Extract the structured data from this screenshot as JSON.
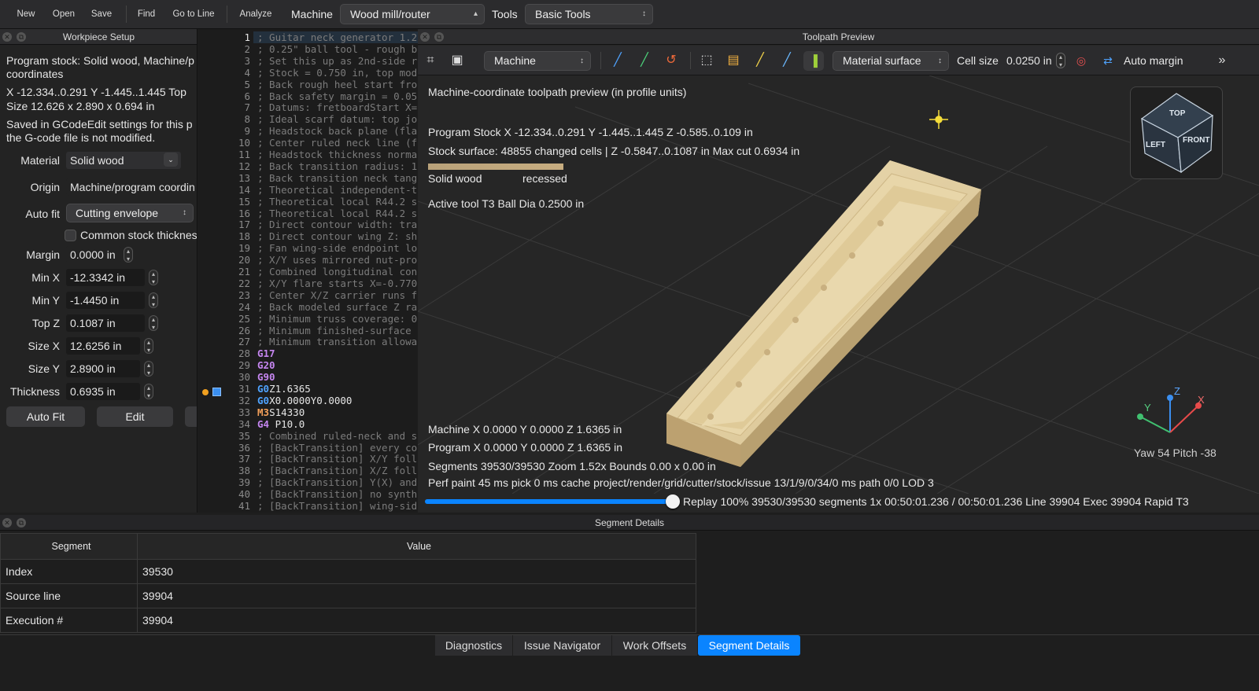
{
  "toolbar": {
    "new_label": "New",
    "open_label": "Open",
    "save_label": "Save",
    "find_label": "Find",
    "goto_label": "Go to Line",
    "analyze_label": "Analyze",
    "machine_label": "Machine",
    "machine_value": "Wood mill/router",
    "tools_label": "Tools",
    "tools_value": "Basic Tools"
  },
  "workpiece": {
    "title": "Workpiece Setup",
    "stock_line1": "Program stock: Solid wood, Machine/p",
    "stock_line2": "coordinates",
    "range_line": "X -12.334..0.291  Y -1.445..1.445  Top",
    "size_line": "Size 12.626 x 2.890 x 0.694 in",
    "note_line1": "Saved in GCodeEdit settings for this p",
    "note_line2": "the G-code file is not modified.",
    "material_label": "Material",
    "material_value": "Solid wood",
    "origin_label": "Origin",
    "origin_value": "Machine/program coordin",
    "autofit_label": "Auto fit",
    "autofit_value": "Cutting envelope",
    "common_stock_label": "Common stock thicknes",
    "margin_label": "Margin",
    "margin_value": "0.0000 in",
    "minx_label": "Min X",
    "minx_value": "-12.3342 in",
    "miny_label": "Min Y",
    "miny_value": "-1.4450 in",
    "topz_label": "Top Z",
    "topz_value": "0.1087 in",
    "sizex_label": "Size X",
    "sizex_value": "12.6256 in",
    "sizey_label": "Size Y",
    "sizey_value": "2.8900 in",
    "thickness_label": "Thickness",
    "thickness_value": "0.6935 in",
    "autofit_button": "Auto Fit",
    "edit_button": "Edit"
  },
  "editor": {
    "lines": [
      {
        "n": "1",
        "t": "; Guitar neck generator 1.2"
      },
      {
        "n": "2",
        "t": "; 0.25\" ball tool - rough b"
      },
      {
        "n": "3",
        "t": "; Set this up as 2nd-side r"
      },
      {
        "n": "4",
        "t": "; Stock = 0.750 in, top mod"
      },
      {
        "n": "5",
        "t": "; Back rough heel start fro"
      },
      {
        "n": "6",
        "t": "; Back safety margin = 0.05"
      },
      {
        "n": "7",
        "t": "; Datums: fretboardStart X="
      },
      {
        "n": "8",
        "t": "; Ideal scarf datum: top jo"
      },
      {
        "n": "9",
        "t": "; Headstock back plane (fla"
      },
      {
        "n": "10",
        "t": "; Center ruled neck line (f"
      },
      {
        "n": "11",
        "t": "; Headstock thickness norma"
      },
      {
        "n": "12",
        "t": "; Back transition radius: 1"
      },
      {
        "n": "13",
        "t": "; Back transition neck tang"
      },
      {
        "n": "14",
        "t": "; Theoretical independent-t"
      },
      {
        "n": "15",
        "t": "; Theoretical local R44.2 s"
      },
      {
        "n": "16",
        "t": "; Theoretical local R44.2 s"
      },
      {
        "n": "17",
        "t": "; Direct contour width: tra"
      },
      {
        "n": "18",
        "t": "; Direct contour wing Z: sh"
      },
      {
        "n": "19",
        "t": "; Fan wing-side endpoint lo"
      },
      {
        "n": "20",
        "t": "; X/Y uses mirrored nut-pro"
      },
      {
        "n": "21",
        "t": "; Combined longitudinal con"
      },
      {
        "n": "22",
        "t": "; X/Y flare starts X=-0.770"
      },
      {
        "n": "23",
        "t": "; Center X/Z carrier runs f"
      },
      {
        "n": "24",
        "t": "; Back modeled surface Z ra"
      },
      {
        "n": "25",
        "t": "; Minimum truss coverage: 0"
      },
      {
        "n": "26",
        "t": "; Minimum finished-surface"
      },
      {
        "n": "27",
        "t": "; Minimum transition allowa"
      },
      {
        "n": "28",
        "t": "G17"
      },
      {
        "n": "29",
        "t": "G20"
      },
      {
        "n": "30",
        "t": "G90"
      },
      {
        "n": "31",
        "t": "G0Z1.6365"
      },
      {
        "n": "32",
        "t": "G0X0.0000Y0.0000"
      },
      {
        "n": "33",
        "t": "M3S14330"
      },
      {
        "n": "34",
        "t": "G4 P10.0"
      },
      {
        "n": "35",
        "t": "; Combined ruled-neck and s"
      },
      {
        "n": "36",
        "t": "; [BackTransition] every co"
      },
      {
        "n": "37",
        "t": "; [BackTransition] X/Y foll"
      },
      {
        "n": "38",
        "t": "; [BackTransition] X/Z foll"
      },
      {
        "n": "39",
        "t": "; [BackTransition] Y(X) and"
      },
      {
        "n": "40",
        "t": "; [BackTransition] no synth"
      },
      {
        "n": "41",
        "t": "; [BackTransition] wing-sid"
      }
    ]
  },
  "preview": {
    "title": "Toolpath Preview",
    "coord_mode": "Machine",
    "surface_mode": "Material surface",
    "cell_size_label": "Cell size",
    "cell_size_value": "0.0250 in",
    "auto_margin_label": "Auto margin",
    "heading": "Machine-coordinate toolpath preview (in profile units)",
    "program_stock": "Program Stock  X -12.334..0.291  Y -1.445..1.445  Z -0.585..0.109 in",
    "stock_surface": "Stock surface: 48855 changed cells   |   Z -0.5847..0.1087 in    Max cut 0.6934 in",
    "legend_left": "Solid wood",
    "legend_right": "recessed",
    "active_tool": "Active tool T3   Ball   Dia 0.2500 in",
    "cube_top": "TOP",
    "cube_left": "LEFT",
    "cube_front": "FRONT",
    "axis_x": "X",
    "axis_y": "Y",
    "axis_z": "Z",
    "yaw_pitch": "Yaw 54   Pitch -38",
    "machine_pos": "Machine X 0.0000   Y 0.0000   Z 1.6365 in",
    "program_pos": "Program X 0.0000   Y 0.0000   Z 1.6365 in",
    "segments_line": "Segments 39530/39530   Zoom 1.52x   Bounds 0.00 x 0.00 in",
    "perf_line": "Perf paint 45 ms   pick 0 ms   cache project/render/grid/cutter/stock/issue 13/1/9/0/34/0 ms   path 0/0 LOD 3",
    "replay_line": "Replay 100%   39530/39530 segments   1x   00:50:01.236 / 00:50:01.236   Line 39904   Exec 39904   Rapid   T3",
    "replay_progress": 1.0
  },
  "segment_details": {
    "title": "Segment Details",
    "col_segment": "Segment",
    "col_value": "Value",
    "rows": [
      {
        "segment": "Index",
        "value": "39530"
      },
      {
        "segment": "Source line",
        "value": "39904"
      },
      {
        "segment": "Execution #",
        "value": "39904"
      }
    ]
  },
  "tabs": {
    "diagnostics": "Diagnostics",
    "issue_navigator": "Issue Navigator",
    "work_offsets": "Work Offsets",
    "segment_details": "Segment Details"
  },
  "colors": {
    "accent": "#0a84ff",
    "wood": "#e2cfa3",
    "gcode_g": "#c586f0",
    "gcode_g0": "#4fa3ff",
    "gcode_m": "#f5a15a"
  }
}
